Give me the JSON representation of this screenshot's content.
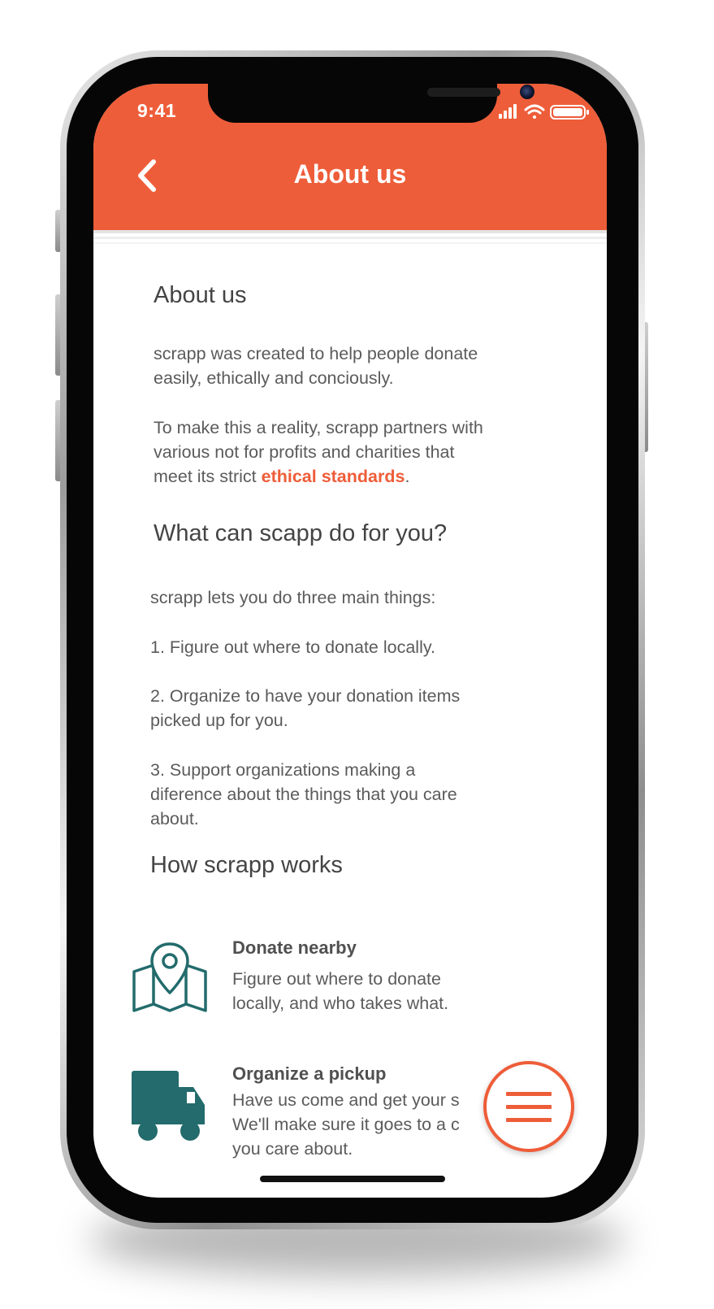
{
  "status_bar": {
    "time": "9:41"
  },
  "header": {
    "title": "About us",
    "back_icon": "chevron-left-icon"
  },
  "content": {
    "section_about": {
      "heading": "About us",
      "para1_line1": "scrapp was created to help people donate",
      "para1_line2": "easily, ethically and conciously.",
      "para2_line1": "To make this a reality, scrapp partners with",
      "para2_line2": "various not for profits and charities that",
      "para2_line3_before": "meet its strict ",
      "para2_link": "ethical standards",
      "para2_line3_after": "."
    },
    "section_what": {
      "heading": "What can scapp do for you?",
      "intro": "scrapp lets you do three main things:",
      "item1": "1. Figure out where to donate locally.",
      "item2_line1": "2. Organize to have your donation items",
      "item2_line2": "picked up for you.",
      "item3_line1": "3. Support organizations making a",
      "item3_line2": "diference about the things that you care",
      "item3_line3": "about."
    },
    "section_how": {
      "heading": "How scrapp works",
      "features": [
        {
          "icon": "map-pin-icon",
          "title": "Donate nearby",
          "desc_line1": "Figure out where to donate",
          "desc_line2": "locally, and who takes what."
        },
        {
          "icon": "truck-icon",
          "title": "Organize a pickup",
          "desc_line1": "Have us come and get your s",
          "desc_line2": "We'll make sure it goes to a c",
          "desc_line3": "you care about."
        }
      ]
    }
  },
  "menu_button": {
    "icon": "hamburger-menu-icon"
  },
  "colors": {
    "brand": "#ee5d39",
    "icon_teal": "#236b6c",
    "text": "#5b5b5b"
  }
}
